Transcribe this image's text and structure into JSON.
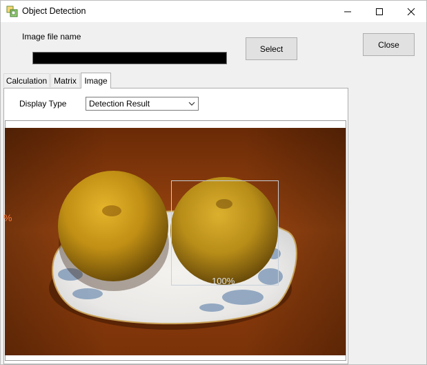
{
  "window": {
    "title": "Object Detection",
    "icon": "object-detection-app-icon",
    "controls": [
      "minimize-icon",
      "maximize-icon",
      "close-icon"
    ]
  },
  "file": {
    "label": "Image file name",
    "value": ""
  },
  "buttons": {
    "select_label": "Select",
    "close_label": "Close"
  },
  "tabs": [
    {
      "label": "Calculation",
      "active": false
    },
    {
      "label": "Matrix",
      "active": false
    },
    {
      "label": "Image",
      "active": true
    }
  ],
  "display": {
    "label": "Display Type",
    "selected": "Detection Result"
  },
  "detections": [
    {
      "label": "100%"
    },
    {
      "label": "%"
    }
  ],
  "colors": {
    "titlebar": "#ffffff",
    "window_bg": "#f0f0f0",
    "button_bg": "#e1e1e1",
    "box_stroke": "#c6d0dc",
    "partial_label": "#ff7a3a"
  }
}
